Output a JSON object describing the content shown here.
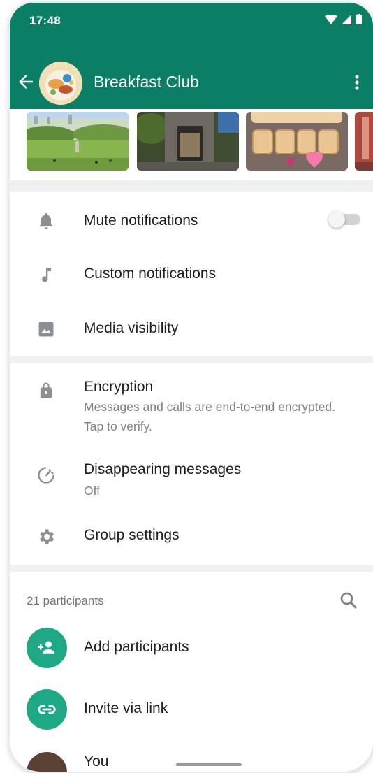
{
  "status_bar": {
    "time": "17:48"
  },
  "header": {
    "title": "Breakfast Club"
  },
  "media": [
    "park",
    "building",
    "bake-sale",
    "partial"
  ],
  "settings": {
    "mute": {
      "label": "Mute notifications",
      "enabled": false
    },
    "custom": {
      "label": "Custom notifications"
    },
    "media_visibility": {
      "label": "Media visibility"
    }
  },
  "security": {
    "encryption": {
      "label": "Encryption",
      "sub": "Messages and calls are end-to-end encrypted. Tap to verify."
    },
    "disappearing": {
      "label": "Disappearing messages",
      "sub": "Off"
    },
    "group_settings": {
      "label": "Group settings"
    }
  },
  "participants": {
    "count": "21 participants",
    "add": {
      "label": "Add participants"
    },
    "invite": {
      "label": "Invite via link"
    },
    "first_member": {
      "label": "You"
    }
  },
  "colors": {
    "brand": "#0b7f66",
    "accent": "#1fa886"
  }
}
